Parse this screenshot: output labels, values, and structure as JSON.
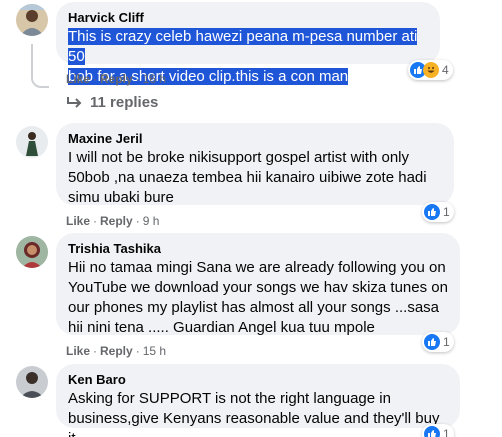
{
  "comments": [
    {
      "author": "Harvick Cliff",
      "text_lines": [
        "This is crazy celeb hawezi peana m-pesa number ati 50",
        "bob for a short video clip.this is a con man"
      ],
      "like_label": "Like",
      "reply_label": "Reply",
      "time": "16 h",
      "reaction_count": "4",
      "reaction_icons": [
        "like-icon",
        "haha-icon"
      ]
    },
    {
      "author": "Maxine Jeril",
      "text_lines": [
        "I will not be broke nikisupport gospel artist with only",
        "50bob ,na unaeza tembea hii kanairo uibiwe zote hadi",
        "simu ubaki bure"
      ],
      "like_label": "Like",
      "reply_label": "Reply",
      "time": "9 h",
      "reaction_count": "1",
      "reaction_icons": [
        "like-icon"
      ]
    },
    {
      "author": "Trishia Tashika",
      "text_lines": [
        "Hii no tamaa mingi Sana we are already following you on",
        "YouTube we download your songs we hav skiza tunes on",
        "our phones my playlist has almost all your songs ...sasa",
        "hii nini tena ..... Guardian Angel kua tuu mpole"
      ],
      "like_label": "Like",
      "reply_label": "Reply",
      "time": "15 h",
      "reaction_count": "1",
      "reaction_icons": [
        "like-icon"
      ]
    },
    {
      "author": "Ken Baro",
      "text_lines": [
        "Asking for SUPPORT is not the right language in",
        "business,give Kenyans reasonable value and they'll buy it."
      ],
      "reaction_count": "1",
      "reaction_icons": [
        "like-icon"
      ]
    }
  ],
  "replies_label": "11 replies",
  "colors": {
    "like": "#1877f2",
    "haha": "#f7b125",
    "highlight": "#1f56d8",
    "bubble": "#f0f2f5"
  }
}
